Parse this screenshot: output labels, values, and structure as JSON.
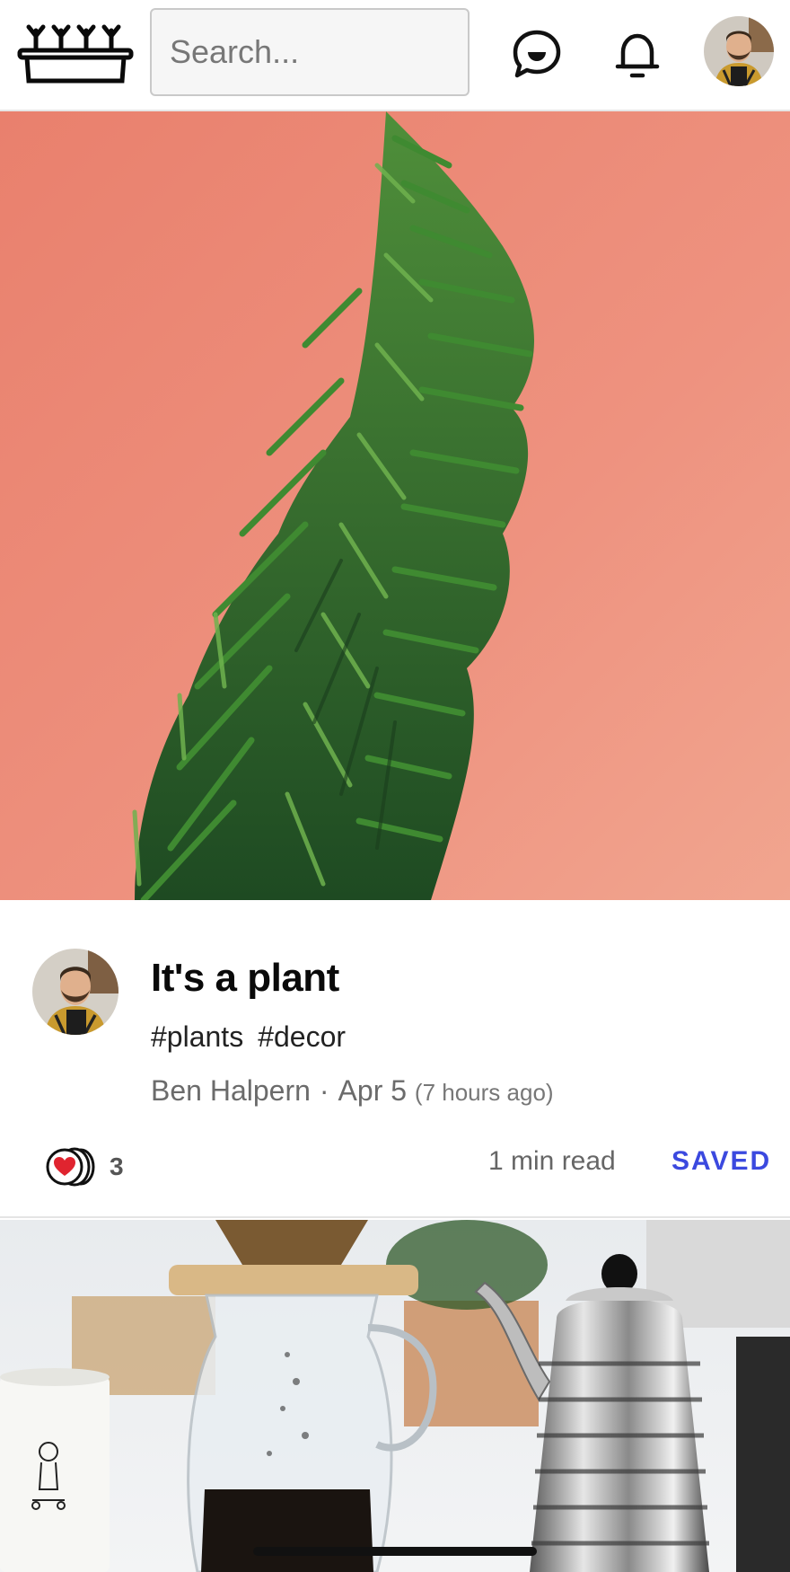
{
  "header": {
    "logo_icon": "planter-logo-icon",
    "search": {
      "placeholder": "Search...",
      "value": ""
    },
    "chat_icon": "chat-bubble-icon",
    "bell_icon": "notification-bell-icon",
    "avatar_icon": "user-avatar"
  },
  "feed": {
    "articles": [
      {
        "cover_icon": "fern-plant-photo",
        "title": "It's a plant",
        "tags": [
          "#plants",
          "#decor"
        ],
        "author": "Ben Halpern",
        "separator": "·",
        "date": "Apr 5",
        "relative_time": "(7 hours ago)",
        "reactions_icon": "heart-reaction-icon",
        "reactions_count": "3",
        "read_time": "1 min read",
        "save_label": "SAVED"
      },
      {
        "cover_icon": "coffee-pour-over-photo"
      }
    ]
  },
  "colors": {
    "accent": "#3b49df",
    "cover_background": "#ec8e7c",
    "heart": "#e0242f"
  }
}
